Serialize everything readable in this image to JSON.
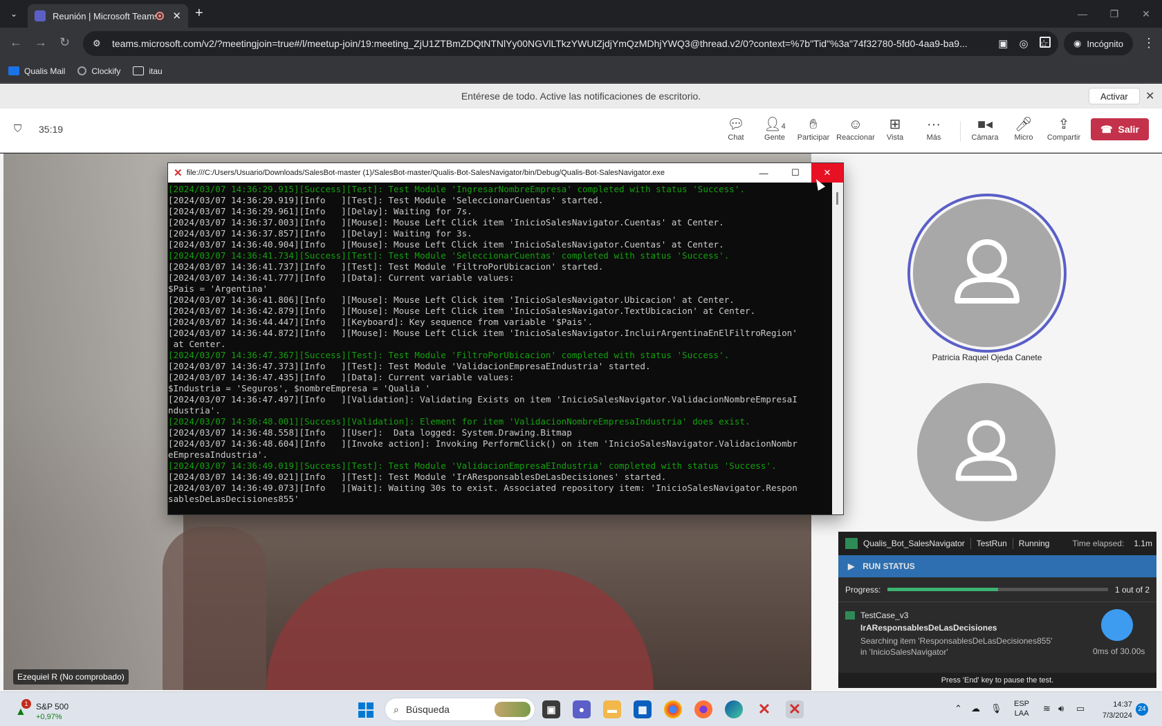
{
  "browser": {
    "tab_title": "Reunión | Microsoft Teams",
    "url": "teams.microsoft.com/v2/?meetingjoin=true#/l/meetup-join/19:meeting_ZjU1ZTBmZDQtNTNlYy00NGVlLTkzYWUtZjdjYmQzMDhjYWQ3@thread.v2/0?context=%7b\"Tid\"%3a\"74f32780-5fd0-4aa9-ba9...",
    "incognito_label": "Incógnito",
    "bookmarks": [
      "Qualis Mail",
      "Clockify",
      "itau"
    ]
  },
  "notification": {
    "text": "Entérese de todo. Active las notificaciones de escritorio.",
    "activate_label": "Activar"
  },
  "meeting": {
    "timer": "35:19",
    "buttons": {
      "chat": "Chat",
      "people": "Gente",
      "people_count": "4",
      "raise": "Participar",
      "react": "Reaccionar",
      "view": "Vista",
      "more": "Más",
      "camera": "Cámara",
      "mic": "Micro",
      "share": "Compartir",
      "leave": "Salir"
    },
    "self_label": "Ezequiel R (No comprobado)",
    "participants": [
      "Patricia Raquel Ojeda Canete"
    ]
  },
  "console": {
    "title": "file:///C:/Users/Usuario/Downloads/SalesBot-master (1)/SalesBot-master/Qualis-Bot-SalesNavigator/bin/Debug/Qualis-Bot-SalesNavigator.exe",
    "lines": [
      {
        "t": "[2024/03/07 14:36:29.915][Success][Test]: Test Module 'IngresarNombreEmpresa' completed with status 'Success'.",
        "ok": true
      },
      {
        "t": "[2024/03/07 14:36:29.919][Info   ][Test]: Test Module 'SeleccionarCuentas' started.",
        "ok": false
      },
      {
        "t": "[2024/03/07 14:36:29.961][Info   ][Delay]: Waiting for 7s.",
        "ok": false
      },
      {
        "t": "[2024/03/07 14:36:37.003][Info   ][Mouse]: Mouse Left Click item 'InicioSalesNavigator.Cuentas' at Center.",
        "ok": false
      },
      {
        "t": "[2024/03/07 14:36:37.857][Info   ][Delay]: Waiting for 3s.",
        "ok": false
      },
      {
        "t": "[2024/03/07 14:36:40.904][Info   ][Mouse]: Mouse Left Click item 'InicioSalesNavigator.Cuentas' at Center.",
        "ok": false
      },
      {
        "t": "[2024/03/07 14:36:41.734][Success][Test]: Test Module 'SeleccionarCuentas' completed with status 'Success'.",
        "ok": true
      },
      {
        "t": "[2024/03/07 14:36:41.737][Info   ][Test]: Test Module 'FiltroPorUbicacion' started.",
        "ok": false
      },
      {
        "t": "[2024/03/07 14:36:41.777][Info   ][Data]: Current variable values:",
        "ok": false
      },
      {
        "t": "$Pais = 'Argentina'",
        "ok": false
      },
      {
        "t": "[2024/03/07 14:36:41.806][Info   ][Mouse]: Mouse Left Click item 'InicioSalesNavigator.Ubicacion' at Center.",
        "ok": false
      },
      {
        "t": "[2024/03/07 14:36:42.879][Info   ][Mouse]: Mouse Left Click item 'InicioSalesNavigator.TextUbicacion' at Center.",
        "ok": false
      },
      {
        "t": "[2024/03/07 14:36:44.447][Info   ][Keyboard]: Key sequence from variable '$Pais'.",
        "ok": false
      },
      {
        "t": "[2024/03/07 14:36:44.872][Info   ][Mouse]: Mouse Left Click item 'InicioSalesNavigator.IncluirArgentinaEnElFiltroRegion'",
        "ok": false
      },
      {
        "t": " at Center.",
        "ok": false
      },
      {
        "t": "[2024/03/07 14:36:47.367][Success][Test]: Test Module 'FiltroPorUbicacion' completed with status 'Success'.",
        "ok": true
      },
      {
        "t": "[2024/03/07 14:36:47.373][Info   ][Test]: Test Module 'ValidacionEmpresaEIndustria' started.",
        "ok": false
      },
      {
        "t": "[2024/03/07 14:36:47.435][Info   ][Data]: Current variable values:",
        "ok": false
      },
      {
        "t": "$Industria = 'Seguros', $nombreEmpresa = 'Qualia '",
        "ok": false
      },
      {
        "t": "[2024/03/07 14:36:47.497][Info   ][Validation]: Validating Exists on item 'InicioSalesNavigator.ValidacionNombreEmpresaI",
        "ok": false
      },
      {
        "t": "ndustria'.",
        "ok": false
      },
      {
        "t": "[2024/03/07 14:36:48.001][Success][Validation]: Element for item 'ValidacionNombreEmpresaIndustria' does exist.",
        "ok": true
      },
      {
        "t": "[2024/03/07 14:36:48.558][Info   ][User]:  Data logged: System.Drawing.Bitmap",
        "ok": false
      },
      {
        "t": "[2024/03/07 14:36:48.604][Info   ][Invoke action]: Invoking PerformClick() on item 'InicioSalesNavigator.ValidacionNombr",
        "ok": false
      },
      {
        "t": "eEmpresaIndustria'.",
        "ok": false
      },
      {
        "t": "[2024/03/07 14:36:49.019][Success][Test]: Test Module 'ValidacionEmpresaEIndustria' completed with status 'Success'.",
        "ok": true
      },
      {
        "t": "[2024/03/07 14:36:49.021][Info   ][Test]: Test Module 'IrAResponsablesDeLasDecisiones' started.",
        "ok": false
      },
      {
        "t": "[2024/03/07 14:36:49.073][Info   ][Wait]: Waiting 30s to exist. Associated repository item: 'InicioSalesNavigator.Respon",
        "ok": false
      },
      {
        "t": "sablesDeLasDecisiones855'",
        "ok": false
      },
      {
        "t": "_",
        "ok": false
      }
    ]
  },
  "ranorex": {
    "project": "Qualis_Bot_SalesNavigator",
    "run": "TestRun",
    "state": "Running",
    "elapsed_label": "Time elapsed:",
    "elapsed_value": "1.1m",
    "run_status": "RUN STATUS",
    "progress_label": "Progress:",
    "progress_text": "1 out of 2",
    "progress_fraction": 0.5,
    "testcase": "TestCase_v3",
    "module": "IrAResponsablesDeLasDecisiones",
    "desc": "Searching item 'ResponsablesDeLasDecisiones855' in 'InicioSalesNavigator'",
    "timer": "0ms of 30.00s",
    "footer": "Press 'End' key to pause the test."
  },
  "taskbar": {
    "stock_name": "S&P 500",
    "stock_change": "+0,97%",
    "stock_badge": "1",
    "search_placeholder": "Búsqueda",
    "lang_top": "ESP",
    "lang_bottom": "LAA",
    "time": "14:37",
    "date": "7/3/2024",
    "notif_count": "24"
  },
  "colors": {
    "teams_purple": "#5b5fc7",
    "leave_red": "#c4314b",
    "console_green": "#13a10e",
    "ranorex_blue": "#2d6fb0"
  }
}
